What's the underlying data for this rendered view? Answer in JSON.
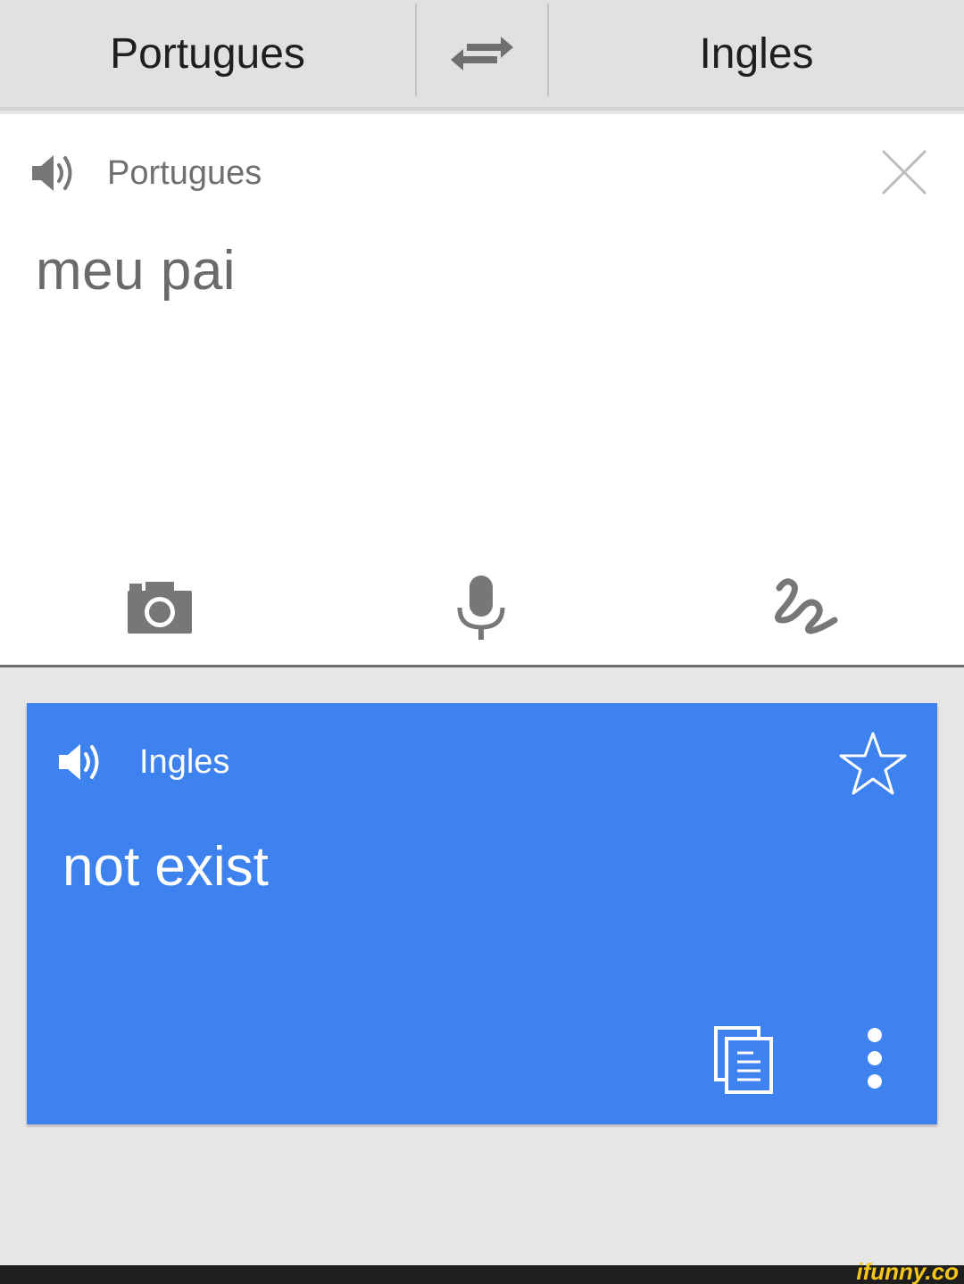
{
  "lang_bar": {
    "source_lang": "Portugues",
    "target_lang": "Ingles",
    "swap_icon": "swap-arrows-icon"
  },
  "input": {
    "lang_label": "Portugues",
    "text": "meu pai",
    "icons": [
      "speaker-icon",
      "close-icon",
      "camera-icon",
      "microphone-icon",
      "handwriting-icon"
    ]
  },
  "result": {
    "lang_label": "Ingles",
    "text": "not exist",
    "icons": [
      "speaker-icon",
      "star-icon",
      "copy-icon",
      "more-vert-icon"
    ]
  },
  "colors": {
    "accent_blue": "#3d82ee",
    "icon_gray": "#777777"
  },
  "watermark": "ifunny.co"
}
